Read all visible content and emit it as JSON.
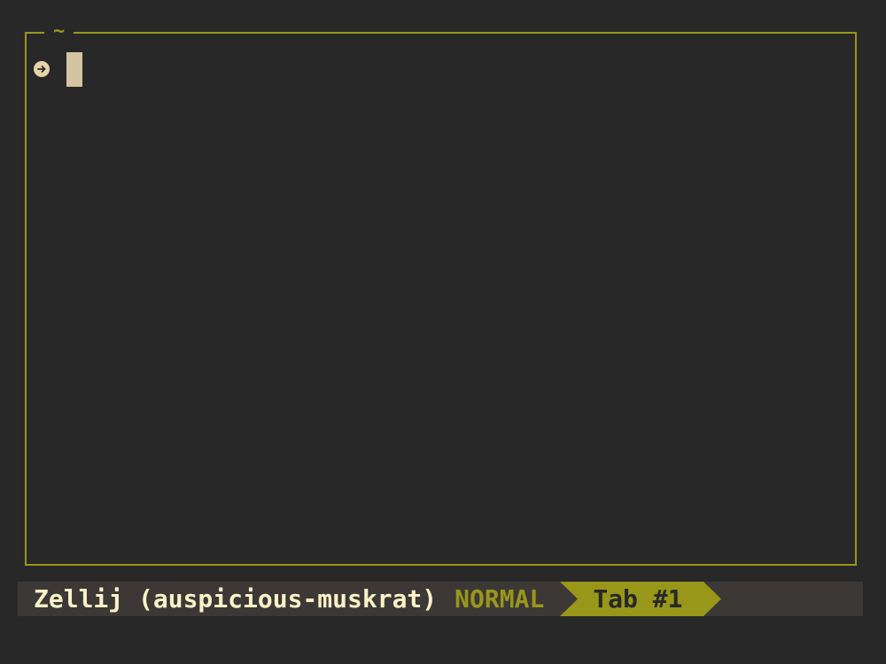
{
  "pane": {
    "title": "~",
    "prompt_icon": "arrow-right-circle-icon"
  },
  "status_bar": {
    "session_label": "Zellij (auspicious-muskrat)",
    "mode": "NORMAL",
    "tabs": [
      {
        "label": "Tab #1",
        "active": true
      }
    ]
  },
  "colors": {
    "background": "#282828",
    "accent": "#98971a",
    "status_bar_bg": "#3c3836",
    "text": "#fbf1c7",
    "cursor": "#d5c4a1"
  }
}
